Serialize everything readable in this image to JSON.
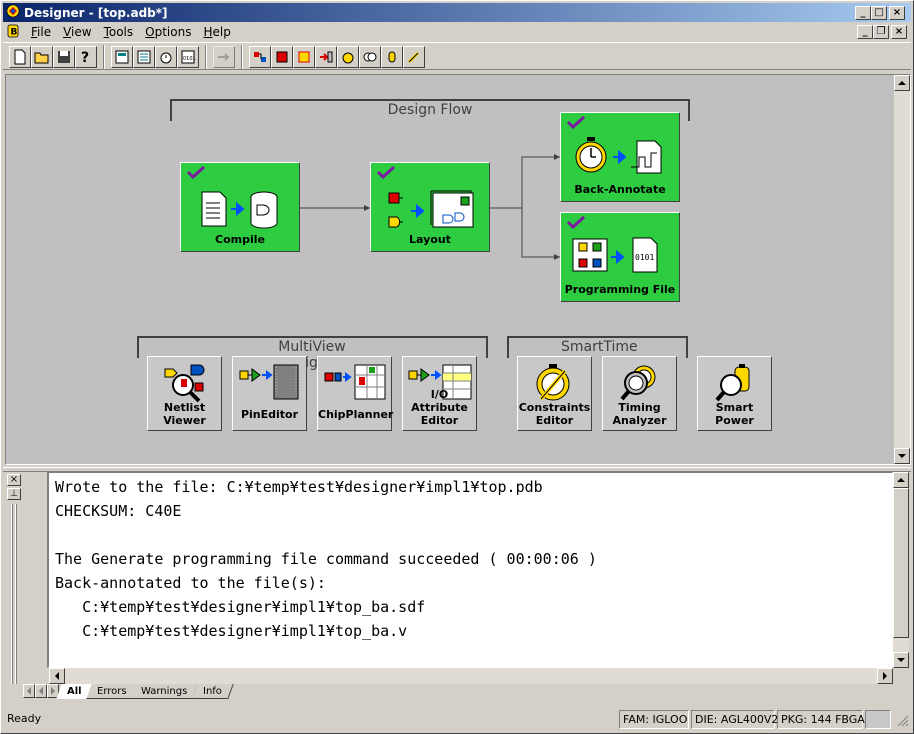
{
  "window": {
    "title": "Designer - [top.adb*]"
  },
  "menu": [
    "File",
    "View",
    "Tools",
    "Options",
    "Help"
  ],
  "flow": {
    "group_label": "Design Flow",
    "steps": [
      {
        "label": "Compile",
        "completed": true
      },
      {
        "label": "Layout",
        "completed": true
      },
      {
        "label": "Back-Annotate",
        "completed": true
      },
      {
        "label": "Programming File",
        "completed": true
      }
    ],
    "step_color": "#2ecc40"
  },
  "tools": {
    "multiview_label": "MultiView Navigator",
    "smarttime_label": "SmartTime",
    "items": [
      {
        "line1": "Netlist",
        "line2": "Viewer"
      },
      {
        "line1": "PinEditor",
        "line2": ""
      },
      {
        "line1": "ChipPlanner",
        "line2": ""
      },
      {
        "line1": "I/O Attribute",
        "line2": "Editor"
      },
      {
        "line1": "Constraints",
        "line2": "Editor"
      },
      {
        "line1": "Timing",
        "line2": "Analyzer"
      },
      {
        "line1": "Smart",
        "line2": "Power"
      }
    ]
  },
  "log": {
    "lines": [
      "Wrote to the file: C:¥temp¥test¥designer¥impl1¥top.pdb",
      "CHECKSUM: C40E",
      "",
      "The Generate programming file command succeeded ( 00:00:06 )",
      "Back-annotated to the file(s):",
      "   C:¥temp¥test¥designer¥impl1¥top_ba.sdf",
      "   C:¥temp¥test¥designer¥impl1¥top_ba.v"
    ],
    "tabs": [
      "All",
      "Errors",
      "Warnings",
      "Info"
    ],
    "active_tab": "All"
  },
  "status": {
    "ready": "Ready",
    "family": "FAM: IGLOO",
    "die": "DIE: AGL400V2",
    "package": "PKG: 144 FBGA"
  }
}
